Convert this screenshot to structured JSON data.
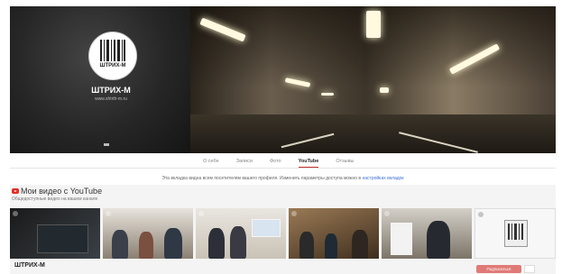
{
  "channel": {
    "name": "ШТРИХ-М",
    "site": "www.shtrih-m.ru",
    "logo_text": "ШТРИХ-М"
  },
  "tabs": [
    {
      "label": "О себе",
      "active": false
    },
    {
      "label": "Записи",
      "active": false
    },
    {
      "label": "Фото",
      "active": false
    },
    {
      "label": "YouTube",
      "active": true
    },
    {
      "label": "Отзывы",
      "active": false
    }
  ],
  "notice": {
    "text": "Эта вкладка видна всем посетителям вашего профиля. Изменить параметры доступа можно в ",
    "link": "настройках вкладок"
  },
  "section": {
    "title": "Мои видео с YouTube",
    "subtitle": "Общедоступные видео на вашем канале"
  },
  "videos": [
    {
      "name": "video-1"
    },
    {
      "name": "video-2"
    },
    {
      "name": "video-3"
    },
    {
      "name": "video-4"
    },
    {
      "name": "video-5"
    },
    {
      "name": "video-6"
    }
  ],
  "bottom": {
    "channel_title": "ШТРИХ-М",
    "subscribe_label": "Подписаться"
  },
  "colors": {
    "accent": "#c4302b",
    "link": "#3b6fd4"
  },
  "icons": [
    "youtube-icon",
    "play-icon"
  ]
}
